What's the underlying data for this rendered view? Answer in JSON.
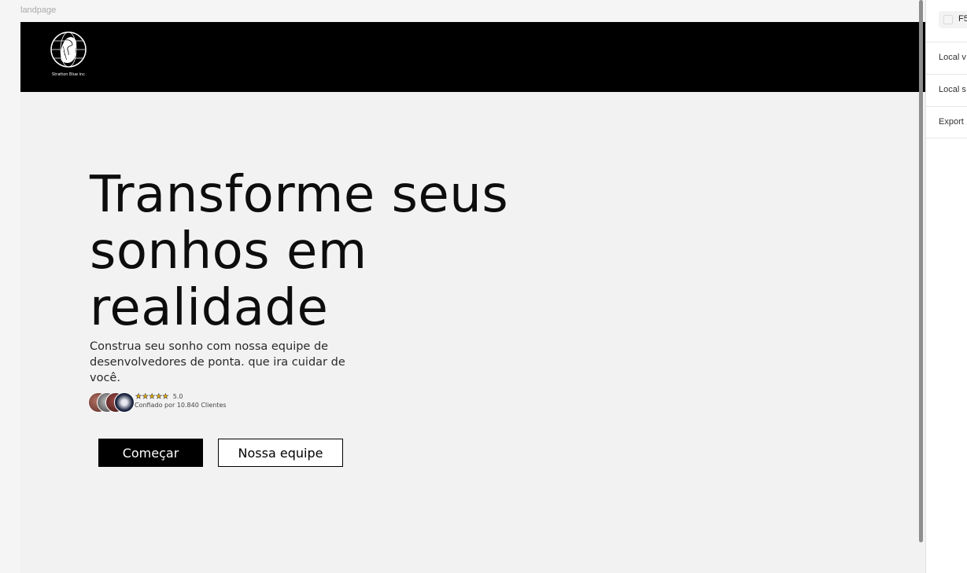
{
  "canvas": {
    "frame_label": "landpage"
  },
  "header": {
    "logo_caption": "Stratton Blue inc"
  },
  "hero": {
    "title_line1": "Transforme seus",
    "title_line2": "sonhos em",
    "title_line3": "realidade",
    "subtitle": "Construa seu sonho com nossa equipe de desenvolvedores de ponta. que ira cuidar de você.",
    "stars": "★★★★★",
    "rating": "5.0",
    "trust_text": "Confiado por 10.840 Clientes",
    "primary_button": "Começar",
    "secondary_button": "Nossa equipe"
  },
  "right_panel": {
    "fill_value": "F5",
    "rows": [
      "Local v",
      "Local s",
      "Export"
    ]
  },
  "colors": {
    "header_bg": "#000000",
    "page_bg": "#f2f2f2",
    "star": "#f2b400"
  },
  "icons": {
    "logo": "lion-globe-logo",
    "rating": "star-icon"
  }
}
